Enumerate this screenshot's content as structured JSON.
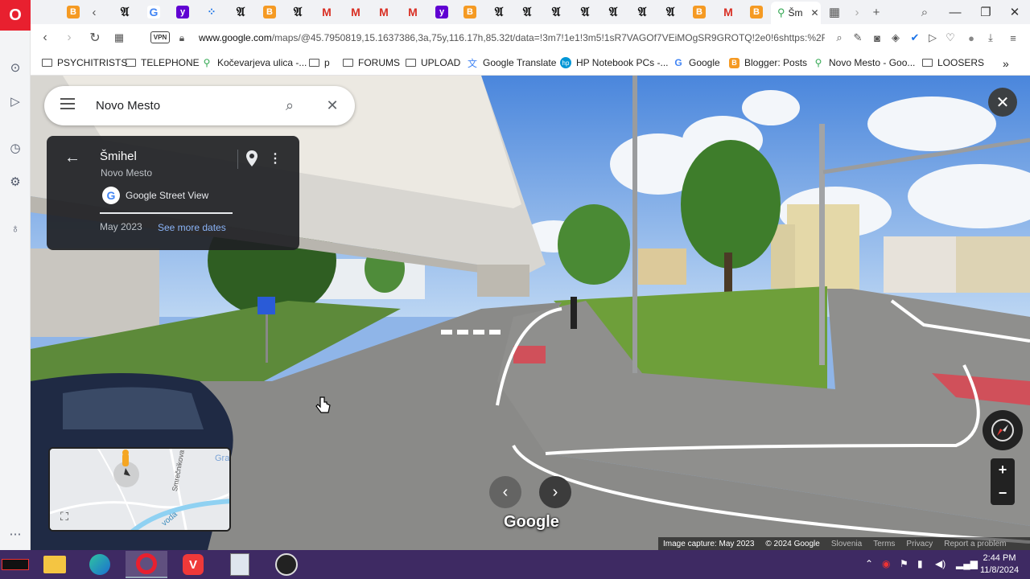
{
  "browser": {
    "active_tab_title": "Šm",
    "url_host": "www.google.com",
    "url_path": "/maps/@45.7950819,15.1637386,3a,75y,116.17h,85.32t/data=!3m7!1e1!3m5!1sR7VAGOf7VEiMOgSR9GROTQ!2e0!6shttps:%2F%",
    "vpn_label": "VPN"
  },
  "bookmarks": [
    {
      "label": "PSYCHITRISTS",
      "icon": "folder-icon"
    },
    {
      "label": "TELEPHONE",
      "icon": "folder-icon"
    },
    {
      "label": "Kočevarjeva ulica -...",
      "icon": "map-pin-icon"
    },
    {
      "label": "p",
      "icon": "folder-icon"
    },
    {
      "label": "FORUMS",
      "icon": "folder-icon"
    },
    {
      "label": "UPLOAD",
      "icon": "folder-icon"
    },
    {
      "label": "Google Translate",
      "icon": "translate-icon"
    },
    {
      "label": "HP Notebook PCs -...",
      "icon": "hp-icon"
    },
    {
      "label": "Google",
      "icon": "google-icon"
    },
    {
      "label": "Blogger: Posts",
      "icon": "blogger-icon"
    },
    {
      "label": "Novo Mesto - Goo...",
      "icon": "map-pin-icon"
    },
    {
      "label": "LOOSERS",
      "icon": "folder-icon"
    }
  ],
  "search": {
    "value": "Novo Mesto"
  },
  "infocard": {
    "title": "Šmihel",
    "subtitle": "Novo Mesto",
    "source": "Google Street View",
    "date": "May 2023",
    "see_more": "See more dates"
  },
  "minimap": {
    "street_label": "Smrečnikova",
    "water_label": "voda",
    "corner_label": "Gra"
  },
  "streetview": {
    "brand": "Google",
    "footer": {
      "capture": "Image capture: May 2023",
      "copyright": "© 2024 Google",
      "country": "Slovenia",
      "terms": "Terms",
      "privacy": "Privacy",
      "report": "Report a problem"
    }
  },
  "taskbar": {
    "time": "2:44 PM",
    "date": "11/8/2024"
  },
  "colors": {
    "opera_red": "#e8202f",
    "taskbar": "#3e2a63",
    "link_blue": "#8ab4f8"
  }
}
